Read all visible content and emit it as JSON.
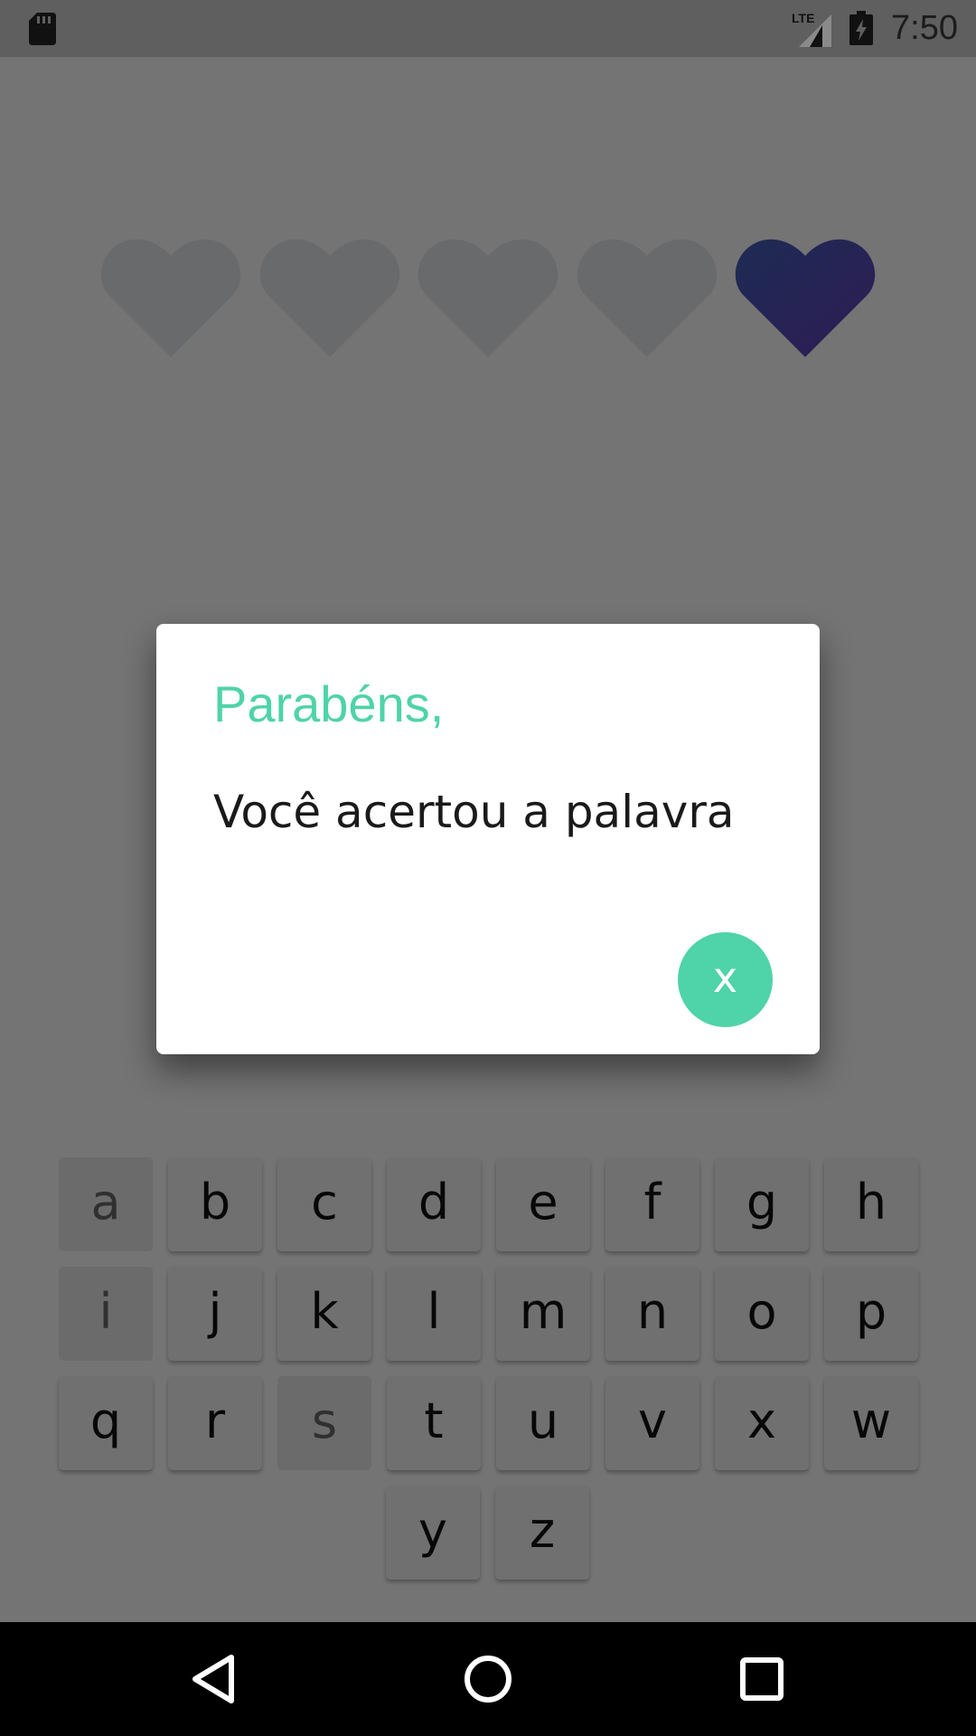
{
  "status_bar": {
    "time": "7:50",
    "network_label": "LTE",
    "icons": [
      "sd-card-icon",
      "lte-signal-icon",
      "battery-charging-icon"
    ]
  },
  "hearts": {
    "total": 5,
    "filled": 1,
    "gradient_colors": [
      "#3f5fb5",
      "#6a3fbf"
    ],
    "empty_color": "#e6e8ee"
  },
  "keyboard": {
    "rows": [
      [
        "a",
        "b",
        "c",
        "d",
        "e",
        "f",
        "g",
        "h"
      ],
      [
        "i",
        "j",
        "k",
        "l",
        "m",
        "n",
        "o",
        "p"
      ],
      [
        "q",
        "r",
        "s",
        "t",
        "u",
        "v",
        "x",
        "w"
      ],
      [
        "y",
        "z"
      ]
    ],
    "used_keys": [
      "a",
      "i",
      "s"
    ]
  },
  "dialog": {
    "title": "Parabéns,",
    "message": "Você acertou a palavra",
    "close_label": "x",
    "accent_color": "#4fd3a8"
  },
  "nav_bar": {
    "buttons": [
      "back-icon",
      "home-icon",
      "recents-icon"
    ]
  }
}
